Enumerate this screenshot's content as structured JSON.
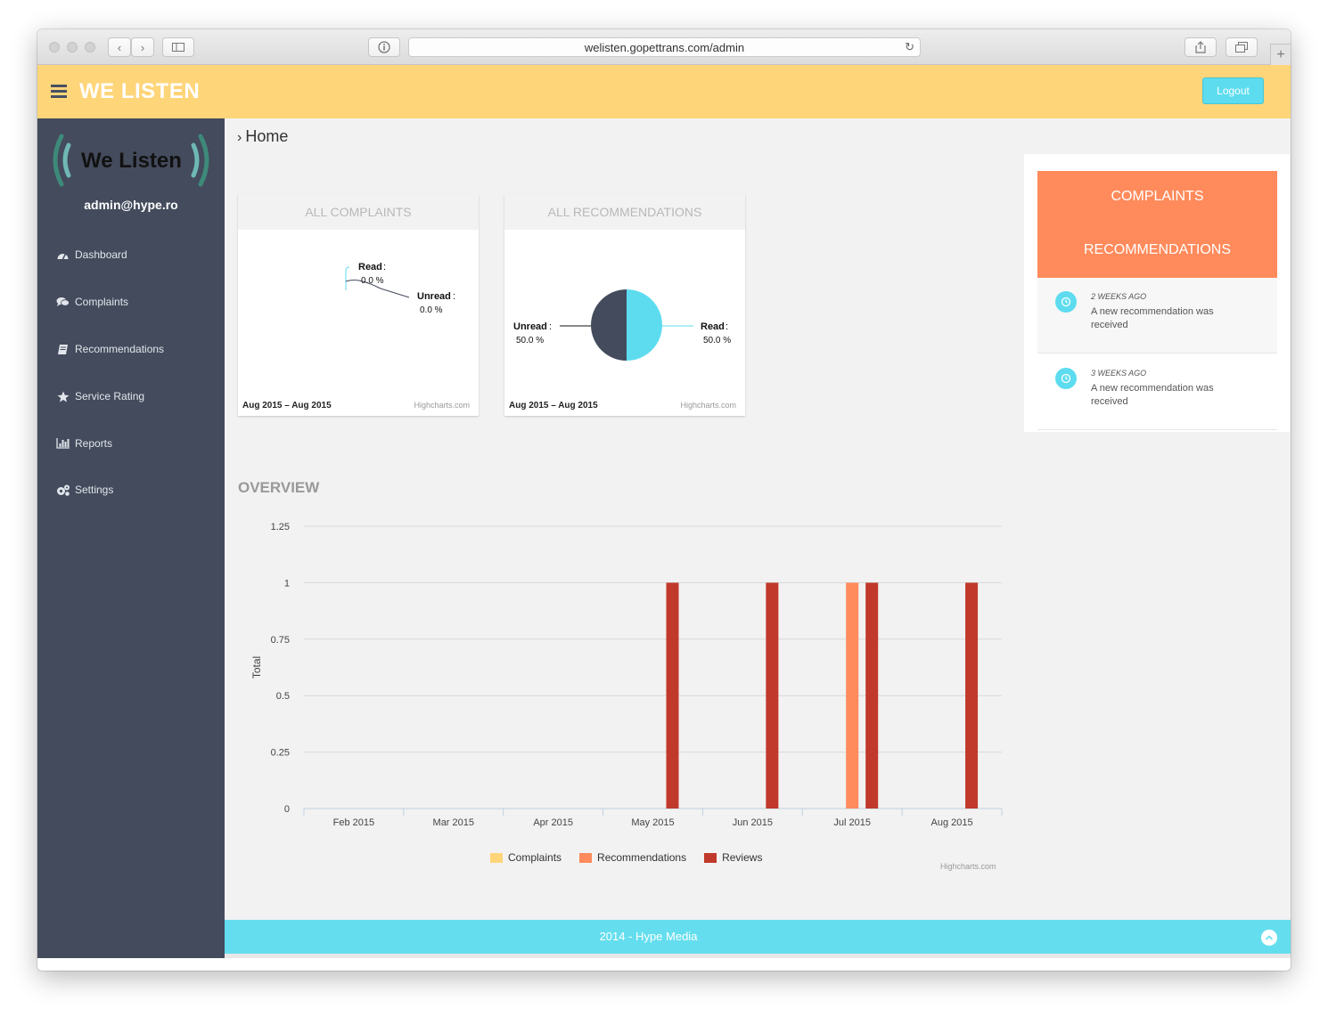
{
  "browser": {
    "url": "welisten.gopettrans.com/admin"
  },
  "header": {
    "brand": "WE LISTEN",
    "logout_label": "Logout",
    "accent": "#ffd57a"
  },
  "sidebar": {
    "logo_text": "We Listen",
    "user_email": "admin@hype.ro",
    "items": [
      {
        "label": "Dashboard",
        "icon": "dashboard-icon"
      },
      {
        "label": "Complaints",
        "icon": "comments-icon"
      },
      {
        "label": "Recommendations",
        "icon": "book-icon"
      },
      {
        "label": "Service Rating",
        "icon": "star-icon"
      },
      {
        "label": "Reports",
        "icon": "bar-chart-icon"
      },
      {
        "label": "Settings",
        "icon": "gears-icon"
      }
    ]
  },
  "breadcrumb": {
    "current": "Home"
  },
  "cards": {
    "complaints": {
      "title": "ALL COMPLAINTS",
      "range": "Aug 2015 – Aug 2015",
      "credit": "Highcharts.com",
      "slices": [
        {
          "name": "Read",
          "value_label": "0.0 %",
          "value": 0.0
        },
        {
          "name": "Unread",
          "value_label": "0.0 %",
          "value": 0.0
        }
      ]
    },
    "recommendations": {
      "title": "ALL RECOMMENDATIONS",
      "range": "Aug 2015 – Aug 2015",
      "credit": "Highcharts.com",
      "slices": [
        {
          "name": "Unread",
          "value_label": "50.0 %",
          "value": 50.0,
          "color": "#434b5c"
        },
        {
          "name": "Read",
          "value_label": "50.0 %",
          "value": 50.0,
          "color": "#5ddcef"
        }
      ]
    }
  },
  "overview": {
    "title": "OVERVIEW",
    "credit": "Highcharts.com"
  },
  "chart_data": {
    "type": "bar",
    "categories": [
      "Feb 2015",
      "Mar 2015",
      "Apr 2015",
      "May 2015",
      "Jun 2015",
      "Jul 2015",
      "Aug 2015"
    ],
    "series": [
      {
        "name": "Complaints",
        "color": "#ffd57a",
        "values": [
          0,
          0,
          0,
          0,
          0,
          0,
          0
        ]
      },
      {
        "name": "Recommendations",
        "color": "#ff8a5b",
        "values": [
          0,
          0,
          0,
          0,
          0,
          1,
          0
        ]
      },
      {
        "name": "Reviews",
        "color": "#c0392b",
        "values": [
          0,
          0,
          0,
          1,
          1,
          1,
          1
        ]
      }
    ],
    "ylabel": "Total",
    "ylim": [
      0,
      1.25
    ],
    "yticks": [
      "0",
      "0.25",
      "0.5",
      "0.75",
      "1",
      "1.25"
    ],
    "grid": true,
    "legend": "bottom-center"
  },
  "activity": {
    "title_line1": "COMPLAINTS",
    "title_line2": "RECOMMENDATIONS",
    "items": [
      {
        "time": "2 WEEKS AGO",
        "text": "A new recommendation was received"
      },
      {
        "time": "3 WEEKS AGO",
        "text": "A new recommendation was received"
      }
    ]
  },
  "footer": {
    "text": "2014 - Hype Media"
  }
}
